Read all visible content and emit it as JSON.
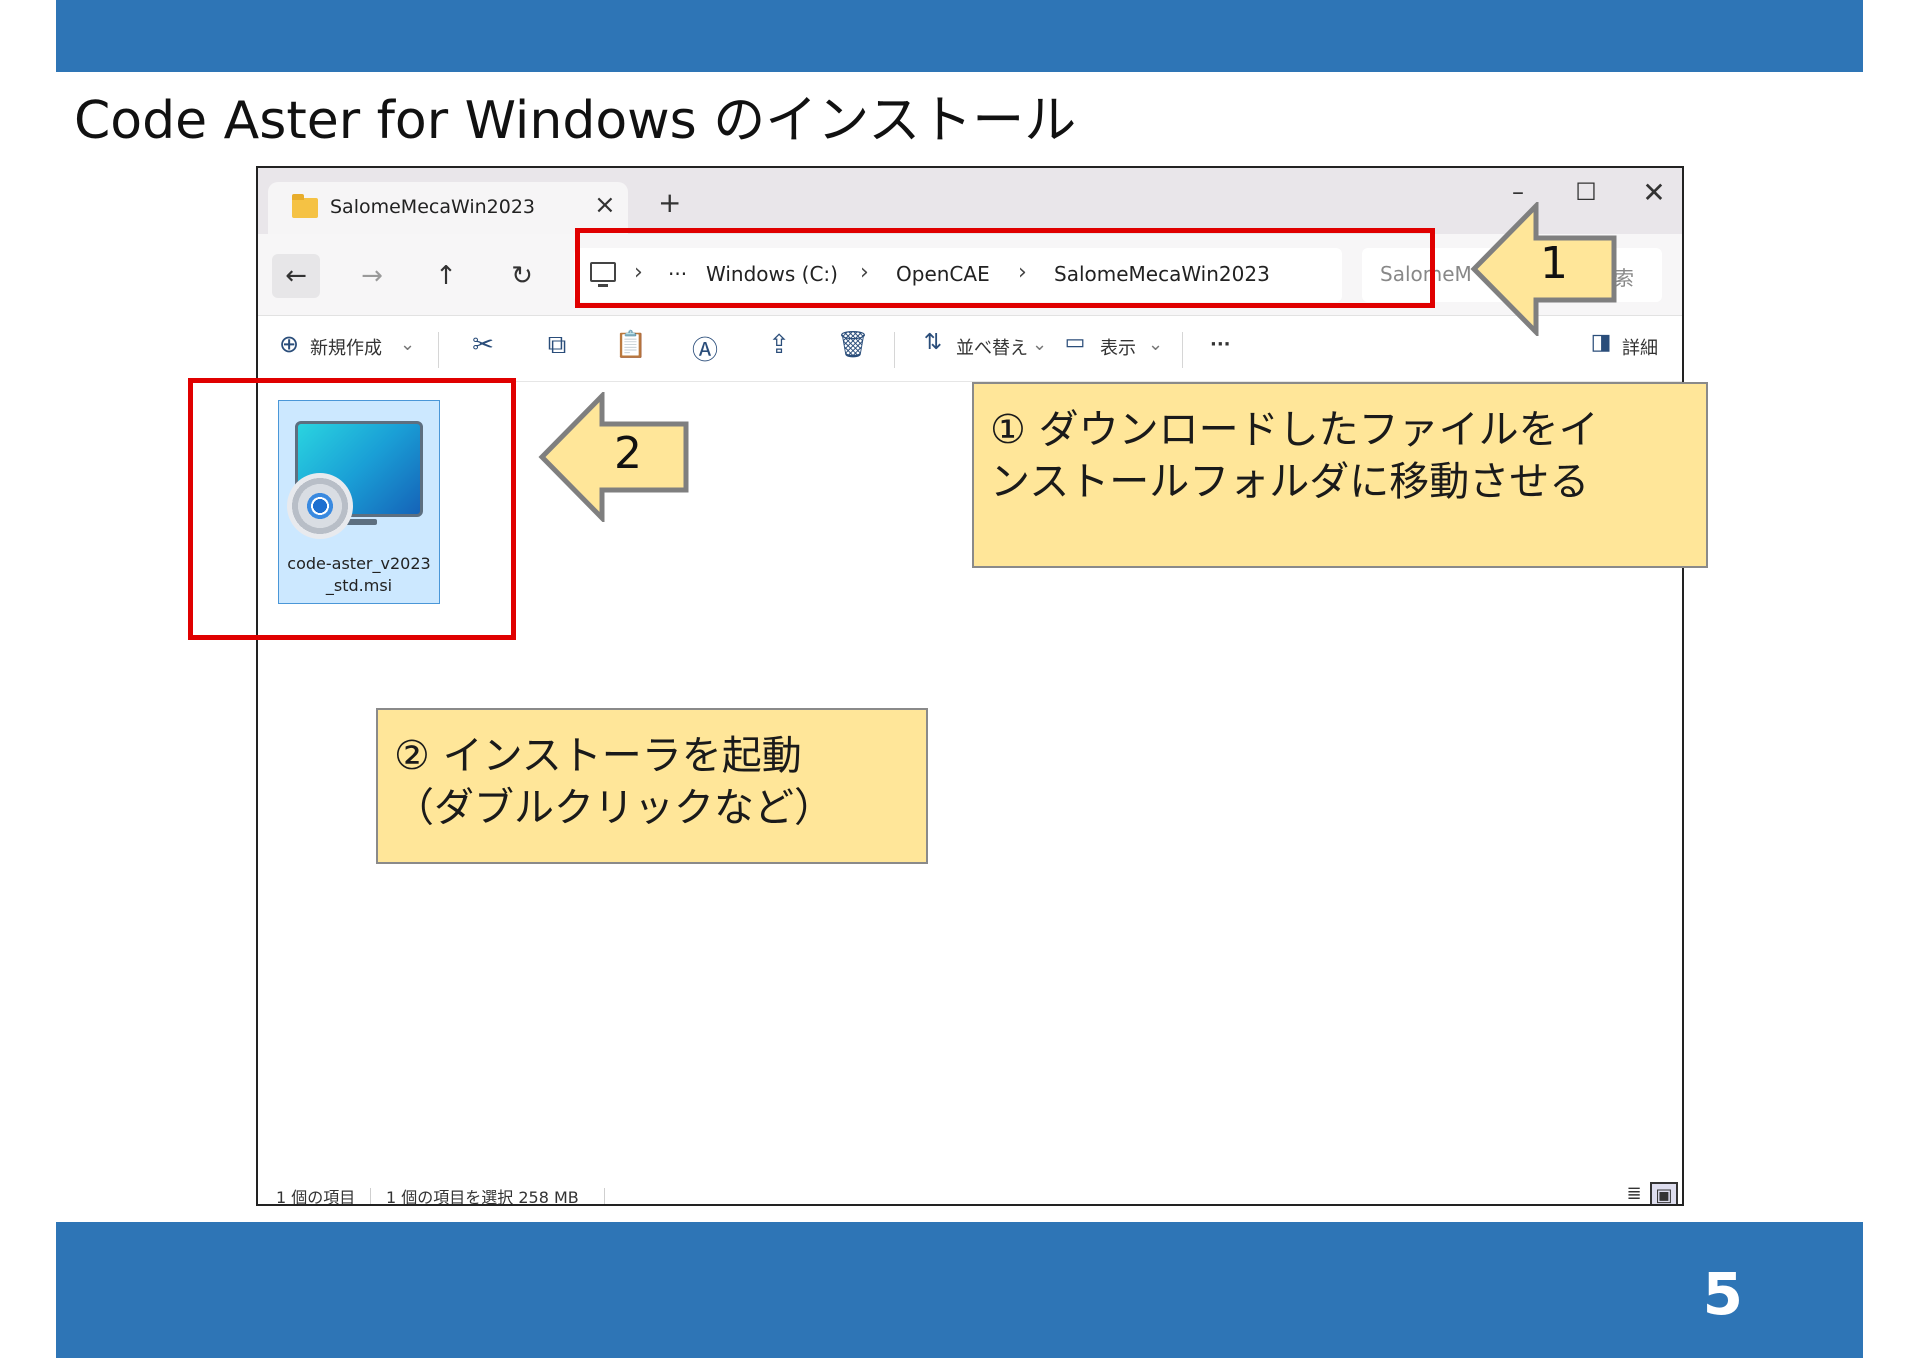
{
  "slide": {
    "title": "Code Aster for Windows のインストール",
    "page_number": "5"
  },
  "window": {
    "tab_title": "SalomeMecaWin2023",
    "tab_close": "×",
    "new_tab": "+",
    "minimize": "–",
    "maximize": "☐",
    "close": "✕"
  },
  "nav": {
    "back": "←",
    "forward": "→",
    "up": "↑",
    "refresh": "↻",
    "breadcrumb": {
      "sep": "›",
      "more": "···",
      "items": [
        "Windows (C:)",
        "OpenCAE",
        "SalomeMecaWin2023"
      ]
    },
    "search_text": "SalomeM",
    "search_label": "検索"
  },
  "toolbar": {
    "new": "新規作成",
    "new_icon": "⊕",
    "dropdown": "⌄",
    "cut": "✂",
    "copy": "⧉",
    "paste": "📋",
    "rename": "Ⓐ",
    "share": "⇪",
    "delete": "🗑",
    "sort_icon": "⇅",
    "sort": "並べ替え",
    "view_icon": "▭",
    "view": "表示",
    "more": "···",
    "details_icon": "◨",
    "details": "詳細"
  },
  "files": [
    {
      "name_line1": "code-aster_v2023",
      "name_line2": "_std.msi"
    }
  ],
  "status": {
    "items": "1 個の項目",
    "selected": "1 個の項目を選択  258 MB",
    "list_view": "≣",
    "icon_view": "▣"
  },
  "annotations": {
    "arrow1": "1",
    "arrow2": "2",
    "callout1_line1": "① ダウンロードしたファイルをイ",
    "callout1_line2": "ンストールフォルダに移動させる",
    "callout2_line1": "② インストーラを起動",
    "callout2_line2": "（ダブルクリックなど）"
  },
  "colors": {
    "slide_bar": "#2e75b6",
    "highlight_box": "#e00000",
    "callout_fill": "#ffe699",
    "selection": "#cce8ff"
  }
}
